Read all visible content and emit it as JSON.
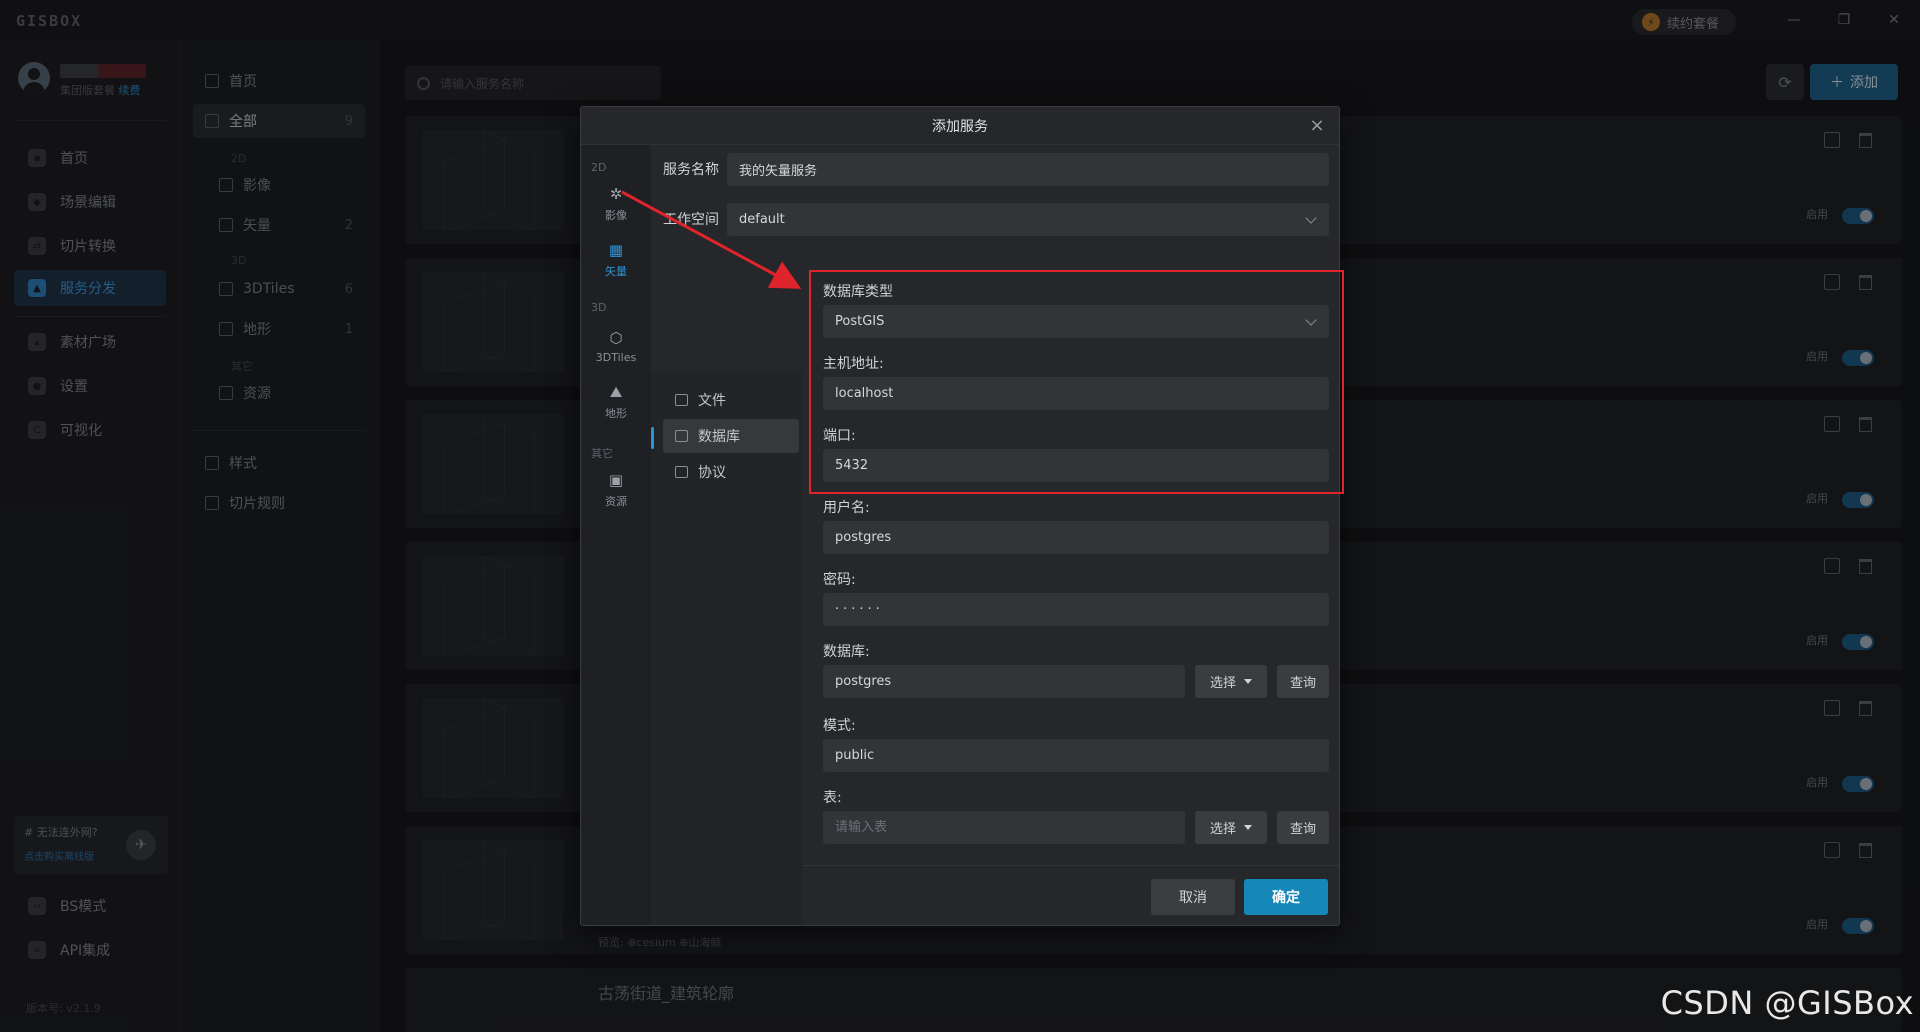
{
  "app": {
    "logo": "GISBOX",
    "renew_pill": "续约套餐",
    "window_controls": [
      "—",
      "❐",
      "✕"
    ]
  },
  "user": {
    "subtitle": "集团版套餐",
    "renew_link": "续费"
  },
  "sidebar": {
    "items": [
      {
        "label": "首页",
        "icon": "home-icon"
      },
      {
        "label": "场景编辑",
        "icon": "cube-icon"
      },
      {
        "label": "切片转换",
        "icon": "transform-icon"
      },
      {
        "label": "服务分发",
        "icon": "upload-icon",
        "active": true
      },
      {
        "label": "素材广场",
        "icon": "image-icon"
      },
      {
        "label": "设置",
        "icon": "gear-icon"
      },
      {
        "label": "可视化",
        "icon": "chart-icon"
      }
    ],
    "promo": {
      "title": "# 无法连外网?",
      "link": "点击购买离线版"
    },
    "bottom_items": [
      {
        "label": "BS模式",
        "icon": "code-icon"
      },
      {
        "label": "API集成",
        "icon": "link-icon"
      }
    ],
    "version": "版本号: v2.1.9"
  },
  "categories": {
    "home": "首页",
    "all": {
      "label": "全部",
      "count": "9"
    },
    "section_2d": "2D",
    "imagery": "影像",
    "vector": {
      "label": "矢量",
      "count": "2"
    },
    "section_3d": "3D",
    "tiles3d": {
      "label": "3DTiles",
      "count": "6"
    },
    "terrain": {
      "label": "地形",
      "count": "1"
    },
    "section_other": "其它",
    "resource": "资源",
    "style": "样式",
    "tile_rule": "切片规则"
  },
  "main": {
    "search_placeholder": "请输入服务名称",
    "add_label": "添加",
    "enable_label": "启用",
    "preview_line": "预览: ⊕cesium  ⊕山海鲸",
    "last_card_title": "古荡街道_建筑轮廓"
  },
  "modal": {
    "title": "添加服务",
    "rail": {
      "sec_2d": "2D",
      "imagery": "影像",
      "vector": "矢量",
      "sec_3d": "3D",
      "tiles3d": "3DTiles",
      "terrain": "地形",
      "sec_other": "其它",
      "resource": "资源"
    },
    "service_name_label": "服务名称",
    "service_name_value": "我的矢量服务",
    "workspace_label": "工作空间",
    "workspace_value": "default",
    "sources": {
      "file": "文件",
      "database": "数据库",
      "protocol": "协议"
    },
    "db_type_label": "数据库类型",
    "db_type_value": "PostGIS",
    "host_label": "主机地址:",
    "host_value": "localhost",
    "port_label": "端口:",
    "port_value": "5432",
    "username_label": "用户名:",
    "username_value": "postgres",
    "password_label": "密码:",
    "password_value": "······",
    "database_label": "数据库:",
    "database_value": "postgres",
    "select_label": "选择",
    "query_label": "查询",
    "schema_label": "模式:",
    "schema_value": "public",
    "table_label": "表:",
    "table_placeholder": "请输入表",
    "cancel_label": "取消",
    "ok_label": "确定"
  },
  "watermark": "CSDN @GISBox",
  "colors": {
    "accent": "#2b93d6",
    "primary_button": "#1588b8",
    "highlight_box": "#e0242b"
  }
}
